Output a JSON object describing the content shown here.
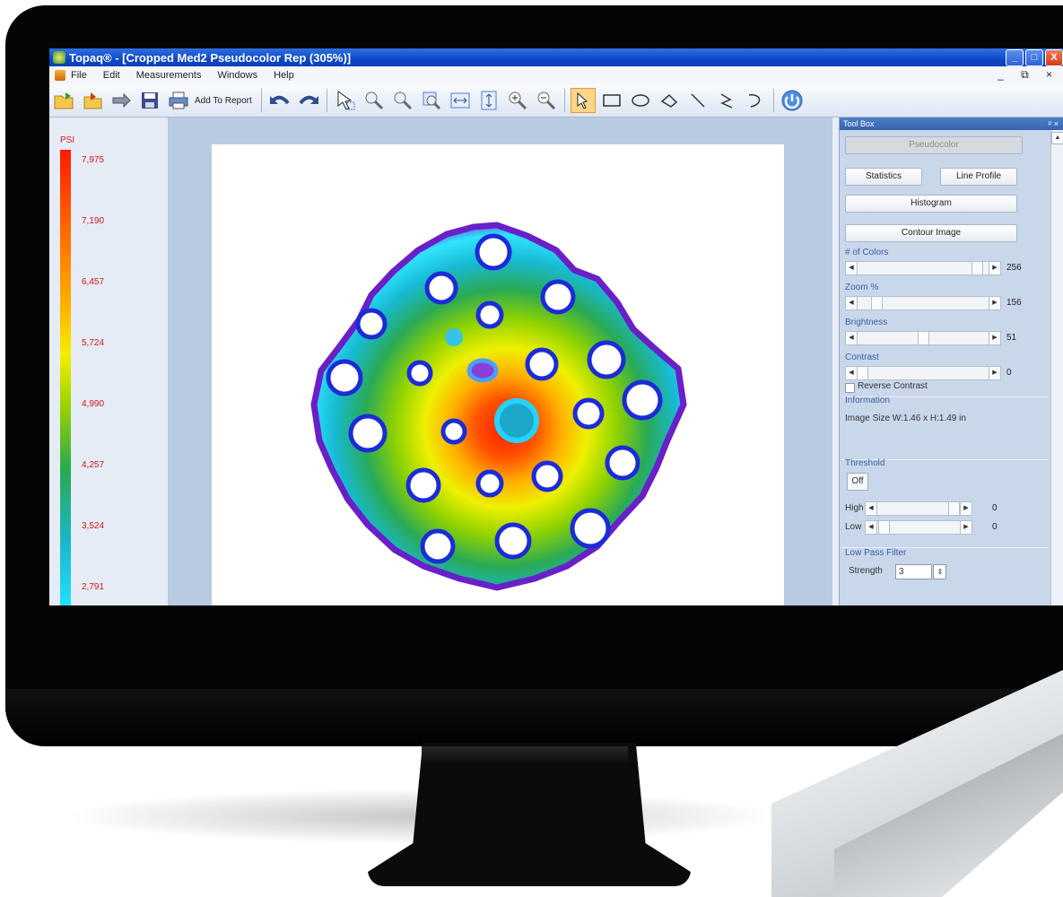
{
  "window": {
    "title": "Topaq® - [Cropped Med2 Pseudocolor Rep (305%)]",
    "controls": [
      "_",
      "□",
      "X"
    ]
  },
  "menu": {
    "items": [
      "File",
      "Edit",
      "Measurements",
      "Windows",
      "Help"
    ],
    "mdi_controls": "_ ⧉ ×"
  },
  "toolbar": {
    "add_to_report": "Add To Report",
    "icons": [
      "open-folder-icon",
      "open-file-icon",
      "forward-icon",
      "save-icon",
      "print-icon",
      "undo-icon",
      "redo-icon",
      "pointer-select-icon",
      "zoom-region-icon",
      "zoom-out-region-icon",
      "pan-icon",
      "fit-width-icon",
      "fit-height-icon",
      "zoom-in-icon",
      "zoom-out-icon",
      "arrow-select-icon",
      "rectangle-icon",
      "ellipse-icon",
      "freehand-icon",
      "line-icon",
      "polyline-icon",
      "curve-icon",
      "power-icon"
    ]
  },
  "legend": {
    "unit": "PSI",
    "ticks": [
      "7,975",
      "7,190",
      "6,457",
      "5,724",
      "4,990",
      "4,257",
      "3,524",
      "2,791"
    ]
  },
  "toolbox": {
    "title": "Tool Box",
    "pin": "ᵖ ×",
    "pseudocolor": "Pseudocolor",
    "statistics": "Statistics",
    "line_profile": "Line Profile",
    "histogram": "Histogram",
    "contour_image": "Contour Image",
    "colors_label": "# of Colors",
    "colors_value": "256",
    "zoom_label": "Zoom %",
    "zoom_value": "156",
    "brightness_label": "Brightness",
    "brightness_value": "51",
    "contrast_label": "Contrast",
    "contrast_value": "0",
    "reverse_contrast": "Reverse Contrast",
    "information_label": "Information",
    "image_size": "Image Size W:1.46 x H:1.49 in",
    "threshold_label": "Threshold",
    "threshold_off": "Off",
    "high_label": "High",
    "high_value": "0",
    "low_label": "Low",
    "low_value": "0",
    "low_pass_label": "Low Pass Filter",
    "strength_label": "Strength",
    "strength_value": "3"
  },
  "colors": {
    "title_bar": "#0d48c8",
    "legend_text": "#d01818",
    "workspace": "#b9cbe1",
    "toolbox": "#c9d7eb"
  }
}
